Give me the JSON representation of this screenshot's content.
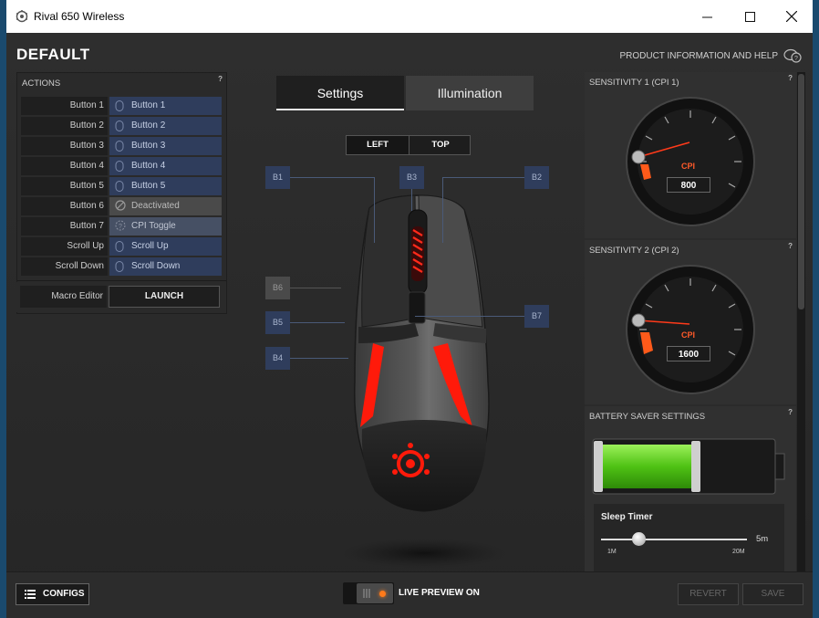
{
  "window": {
    "title": "Rival 650 Wireless"
  },
  "header": {
    "config_name": "DEFAULT",
    "help_link": "PRODUCT INFORMATION AND HELP"
  },
  "actions": {
    "title": "ACTIONS",
    "help": "?",
    "rows": [
      {
        "label": "Button 1",
        "binding": "Button 1"
      },
      {
        "label": "Button 2",
        "binding": "Button 2"
      },
      {
        "label": "Button 3",
        "binding": "Button 3"
      },
      {
        "label": "Button 4",
        "binding": "Button 4"
      },
      {
        "label": "Button 5",
        "binding": "Button 5"
      },
      {
        "label": "Button 6",
        "binding": "Deactivated"
      },
      {
        "label": "Button 7",
        "binding": "CPI Toggle"
      },
      {
        "label": "Scroll Up",
        "binding": "Scroll Up"
      },
      {
        "label": "Scroll Down",
        "binding": "Scroll Down"
      }
    ],
    "macro_label": "Macro Editor",
    "launch_label": "LAUNCH"
  },
  "tabs": [
    {
      "label": "Settings",
      "active": true
    },
    {
      "label": "Illumination",
      "active": false
    }
  ],
  "view": {
    "left": "LEFT",
    "top": "TOP",
    "selected": "LEFT"
  },
  "buttons": {
    "b1": "B1",
    "b2": "B2",
    "b3": "B3",
    "b4": "B4",
    "b5": "B5",
    "b6": "B6",
    "b7": "B7"
  },
  "sensitivity1": {
    "title": "SENSITIVITY 1 (CPI 1)",
    "help": "?",
    "unit": "CPI",
    "value": "800"
  },
  "sensitivity2": {
    "title": "SENSITIVITY 2 (CPI 2)",
    "help": "?",
    "unit": "CPI",
    "value": "1600"
  },
  "battery": {
    "title": "BATTERY SAVER SETTINGS",
    "help": "?",
    "level": 0.55,
    "sleep_title": "Sleep Timer",
    "sleep_value": "5m",
    "sleep_min": "1M",
    "sleep_max": "20M"
  },
  "bottom": {
    "configs_label": "CONFIGS",
    "live_preview_label": "LIVE PREVIEW ON",
    "revert_label": "REVERT",
    "save_label": "SAVE"
  },
  "colors": {
    "accent": "#ff5a2a",
    "binding_bg": "#2f3d5c",
    "battery": "#5ed21a"
  }
}
